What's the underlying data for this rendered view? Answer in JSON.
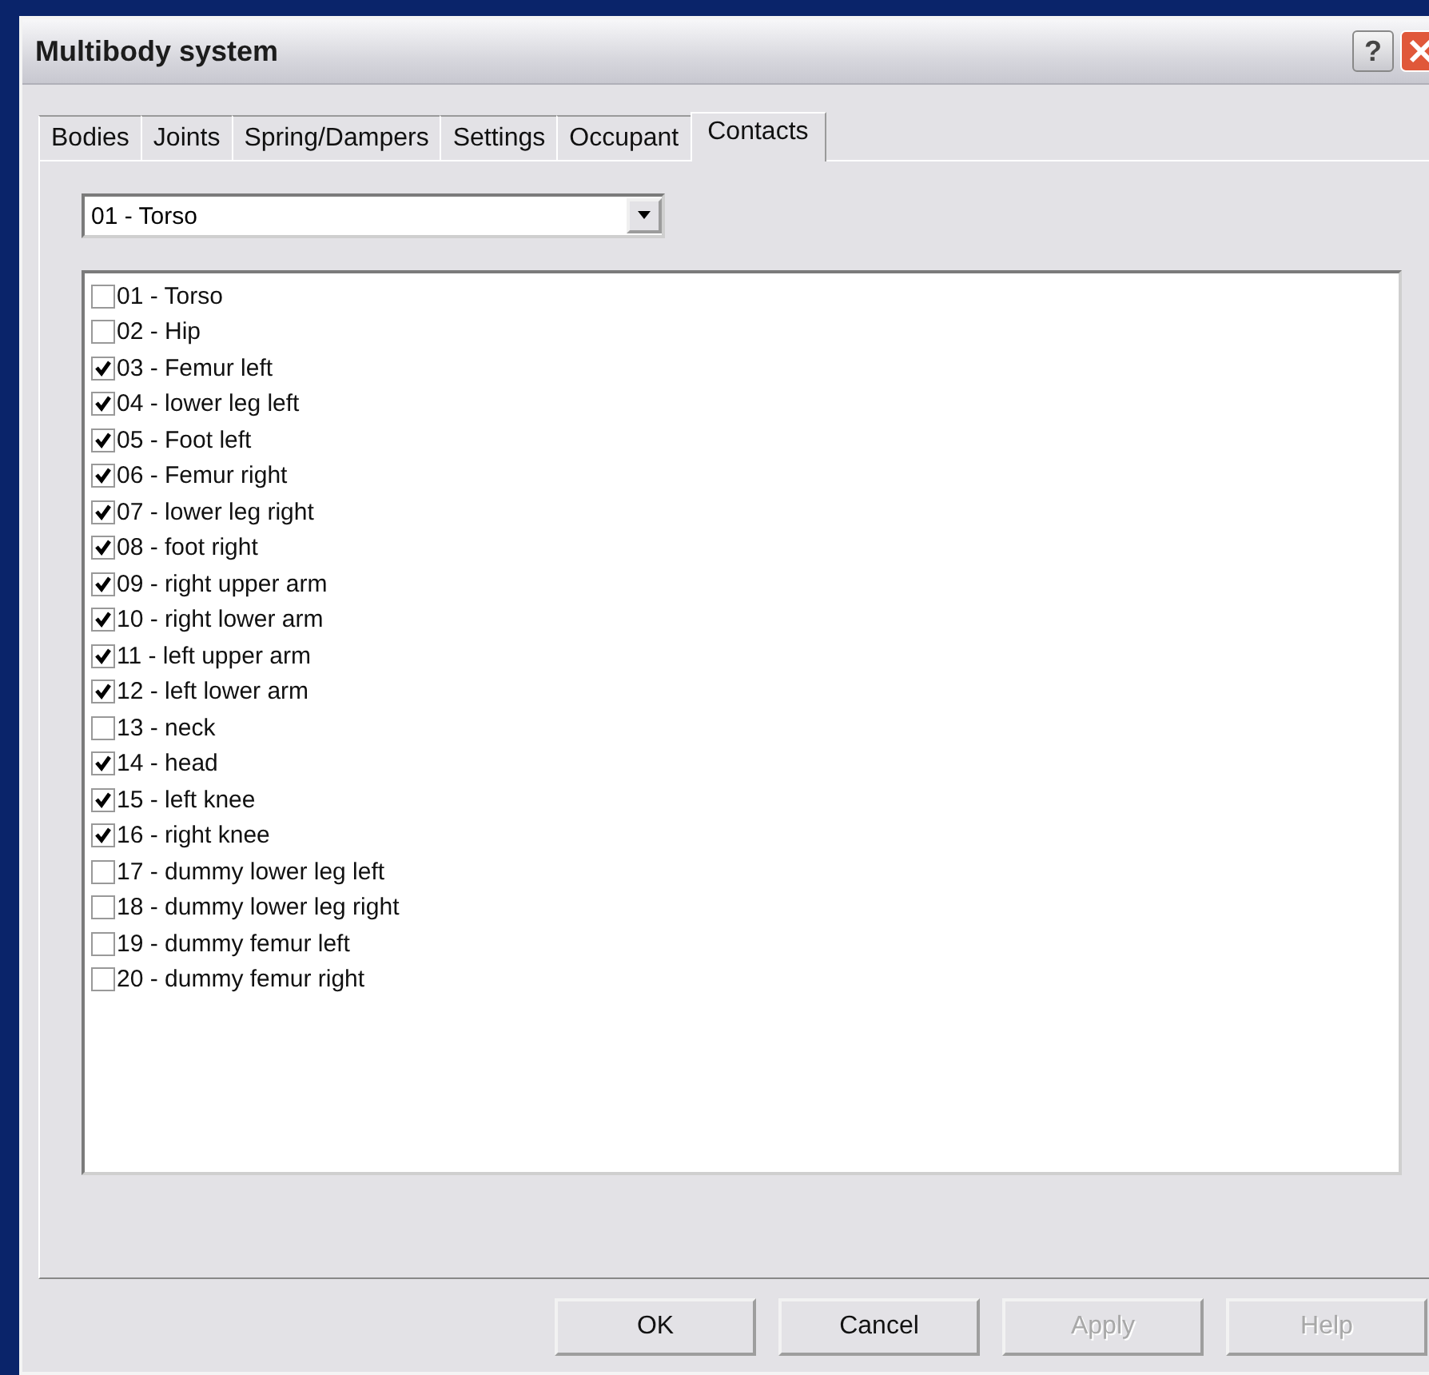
{
  "window": {
    "title": "Multibody system",
    "help_button": "?"
  },
  "tabs": [
    {
      "label": "Bodies",
      "selected": false
    },
    {
      "label": "Joints",
      "selected": false
    },
    {
      "label": "Spring/Dampers",
      "selected": false
    },
    {
      "label": "Settings",
      "selected": false
    },
    {
      "label": "Occupant",
      "selected": false
    },
    {
      "label": "Contacts",
      "selected": true
    }
  ],
  "body_select": {
    "value": "01 - Torso"
  },
  "contacts": [
    {
      "label": "01 - Torso",
      "checked": false
    },
    {
      "label": "02 - Hip",
      "checked": false
    },
    {
      "label": "03 - Femur left",
      "checked": true
    },
    {
      "label": "04 - lower leg left",
      "checked": true
    },
    {
      "label": "05 - Foot left",
      "checked": true
    },
    {
      "label": "06 - Femur right",
      "checked": true
    },
    {
      "label": "07 - lower leg right",
      "checked": true
    },
    {
      "label": "08 - foot right",
      "checked": true
    },
    {
      "label": "09 - right upper arm",
      "checked": true
    },
    {
      "label": "10 - right lower arm",
      "checked": true
    },
    {
      "label": "11 - left upper arm",
      "checked": true
    },
    {
      "label": "12 - left lower arm",
      "checked": true
    },
    {
      "label": "13 - neck",
      "checked": false
    },
    {
      "label": "14 - head",
      "checked": true
    },
    {
      "label": "15 - left knee",
      "checked": true
    },
    {
      "label": "16 - right knee",
      "checked": true
    },
    {
      "label": "17 - dummy lower leg left",
      "checked": false
    },
    {
      "label": "18 - dummy lower leg right",
      "checked": false
    },
    {
      "label": "19 - dummy femur left",
      "checked": false
    },
    {
      "label": "20 - dummy femur right",
      "checked": false
    }
  ],
  "buttons": [
    {
      "label": "OK",
      "disabled": false
    },
    {
      "label": "Cancel",
      "disabled": false
    },
    {
      "label": "Apply",
      "disabled": true
    },
    {
      "label": "Help",
      "disabled": true
    }
  ]
}
